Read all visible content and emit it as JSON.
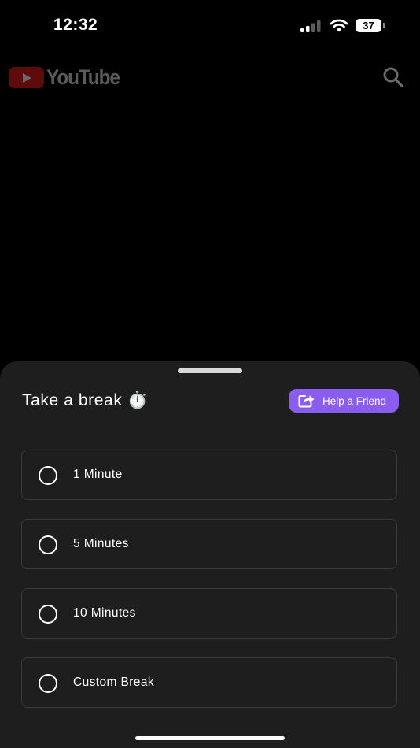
{
  "status_bar": {
    "time": "12:32",
    "battery_level": "37"
  },
  "header": {
    "logo_text": "YouTube"
  },
  "break_sheet": {
    "title": "Take a break ⏱️",
    "help_button_label": "Help a Friend",
    "options": [
      {
        "label": "1 Minute",
        "selected": false
      },
      {
        "label": "5 Minutes",
        "selected": false
      },
      {
        "label": "10 Minutes",
        "selected": false
      },
      {
        "label": "Custom Break",
        "selected": false
      }
    ]
  },
  "colors": {
    "background": "#000000",
    "sheet_background": "#1e1e1e",
    "accent": "#8a5cf0",
    "option_border": "#3a3a3a"
  },
  "icons": {
    "signal": "signal-icon",
    "wifi": "wifi-icon",
    "search": "search-icon",
    "share": "share-icon",
    "radio": "radio-unchecked-icon"
  }
}
